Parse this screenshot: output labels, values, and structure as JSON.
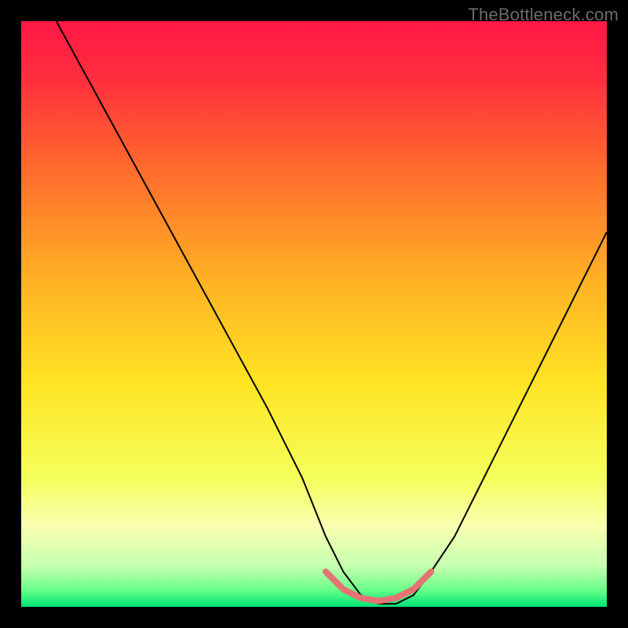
{
  "watermark": {
    "text": "TheBottleneck.com"
  },
  "chart_data": {
    "type": "line",
    "title": "",
    "xlabel": "",
    "ylabel": "",
    "xlim": [
      0,
      100
    ],
    "ylim": [
      0,
      100
    ],
    "grid": false,
    "legend": false,
    "background_gradient": {
      "stops": [
        {
          "pos": 0.0,
          "color": "#ff1744"
        },
        {
          "pos": 0.1,
          "color": "#ff2f3e"
        },
        {
          "pos": 0.25,
          "color": "#ff6a2d"
        },
        {
          "pos": 0.45,
          "color": "#ffb424"
        },
        {
          "pos": 0.62,
          "color": "#ffe424"
        },
        {
          "pos": 0.78,
          "color": "#f4ff5a"
        },
        {
          "pos": 0.86,
          "color": "#faffb0"
        },
        {
          "pos": 0.93,
          "color": "#c6ffb0"
        },
        {
          "pos": 0.97,
          "color": "#6cff8a"
        },
        {
          "pos": 1.0,
          "color": "#00e676"
        }
      ]
    },
    "series": [
      {
        "name": "bottleneck-curve",
        "color": "#000000",
        "width": 2,
        "x": [
          6,
          12,
          18,
          24,
          30,
          36,
          42,
          48,
          52,
          55,
          58,
          61,
          64,
          67,
          70,
          74,
          80,
          86,
          92,
          100
        ],
        "y": [
          100,
          89,
          78,
          67,
          56,
          45,
          34,
          22,
          12,
          6,
          2,
          0.5,
          0.5,
          2,
          6,
          12,
          24,
          36,
          48,
          64
        ]
      },
      {
        "name": "optimal-band",
        "color": "#e57373",
        "width": 8,
        "linecap": "round",
        "x": [
          52,
          55,
          58,
          61,
          64,
          67,
          70
        ],
        "y": [
          6,
          3,
          1.5,
          1,
          1.5,
          3,
          6
        ]
      }
    ]
  }
}
